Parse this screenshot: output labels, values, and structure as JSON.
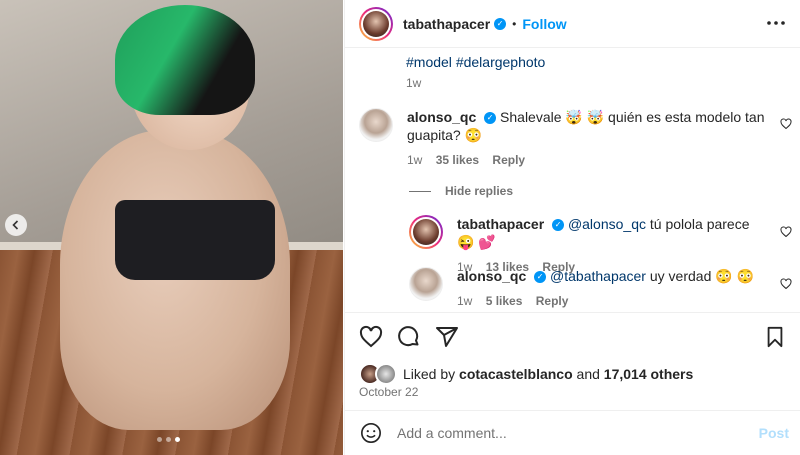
{
  "post": {
    "author": "tabathapacer",
    "separator": "•",
    "follow_label": "Follow",
    "more_icon": "more-icon",
    "verified_glyph": "✓",
    "carousel": {
      "active_index": 2,
      "count": 3
    }
  },
  "caption": {
    "hashtags": [
      "#model",
      "#delargephoto"
    ],
    "time": "1w"
  },
  "comments": [
    {
      "user": "alonso_qc",
      "text": "Shalevale 🤯 🤯 quién es esta modelo tan guapita? 😳",
      "time": "1w",
      "likes": "35 likes",
      "reply": "Reply"
    }
  ],
  "hide_replies_label": "Hide replies",
  "replies": [
    {
      "user": "tabathapacer",
      "mention": "@alonso_qc",
      "text": "tú polola parece 😜 💕",
      "time": "1w",
      "likes": "13 likes",
      "reply": "Reply"
    },
    {
      "user": "alonso_qc",
      "mention": "@tabathapacer",
      "text": "uy verdad 😳 😳",
      "time": "1w",
      "likes": "5 likes",
      "reply": "Reply"
    }
  ],
  "likes": {
    "prefix": "Liked by",
    "user": "cotacastelblanco",
    "middle": "and",
    "others": "17,014 others"
  },
  "date": "October 22",
  "add_comment": {
    "placeholder": "Add a comment...",
    "post_label": "Post"
  },
  "colors": {
    "accent": "#0095f6",
    "post_disabled": "#b2dffc",
    "muted": "#737373"
  }
}
